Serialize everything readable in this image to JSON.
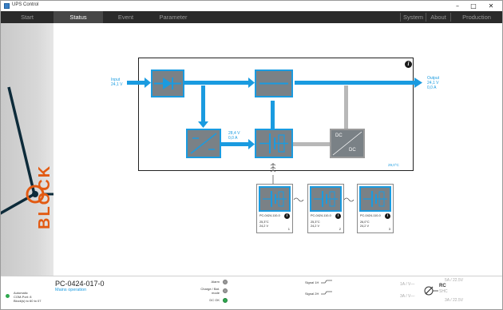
{
  "window": {
    "title": "UPS Control",
    "minimize": "–",
    "maximize": "□",
    "close": "✕"
  },
  "menu": {
    "left_tabs": [
      "Start",
      "Status",
      "Event",
      "Parameter"
    ],
    "active_tab": "Status",
    "right_tabs": [
      "System",
      "About",
      "Production"
    ]
  },
  "brand": {
    "logo_text": "BLOCK"
  },
  "diagram": {
    "input_label": "Input",
    "input_voltage": "24,1 V",
    "output_label": "Output",
    "output_voltage": "24,1 V",
    "output_current": "0,0 A",
    "charger_voltage": "28,4 V",
    "charger_current": "0,0 A",
    "box_temperature": "29,0°C",
    "dc_top": "DC",
    "dc_bottom": "DC",
    "info_symbol": "i",
    "colors": {
      "flow": "#1a9be0",
      "inactive": "#b8b8b8",
      "block_fill": "#7a8186"
    }
  },
  "modules": [
    {
      "name": "PC-0424-110-0",
      "temperature": "25,3°C",
      "voltage": "24,2 V",
      "index": "1",
      "info_symbol": "i"
    },
    {
      "name": "PC-0424-110-0",
      "temperature": "25,3°C",
      "voltage": "24,2 V",
      "index": "2",
      "info_symbol": "i"
    },
    {
      "name": "PC-0424-110-0",
      "temperature": "26,0°C",
      "voltage": "24,2 V",
      "index": "3",
      "info_symbol": "i"
    }
  ],
  "status": {
    "auto_line1": "Automatic",
    "auto_line2": "COM-Port: 8",
    "auto_line3": "Block(s) to 60 to 07",
    "device_name": "PC-0424-017-0",
    "mode": "Mains operation",
    "indicators": [
      {
        "label": "Alarm",
        "color": "#9a9a9a"
      },
      {
        "label": "Charge / Bat. mode",
        "color": "#9a9a9a"
      },
      {
        "label": "DC OK",
        "color": "#2fa84f"
      }
    ],
    "signals": [
      {
        "label": "Signal 1H"
      },
      {
        "label": "Signal 2H"
      }
    ],
    "rc": {
      "top_right": "5A / 22.5V",
      "top_left": "1A / V—",
      "center": "RC",
      "center_sub": "SHC",
      "bottom_left": "3A / V—",
      "bottom_right": "3A / 22.5V"
    },
    "colors": {
      "ok": "#2fa84f",
      "accent": "#1a9be0"
    }
  }
}
